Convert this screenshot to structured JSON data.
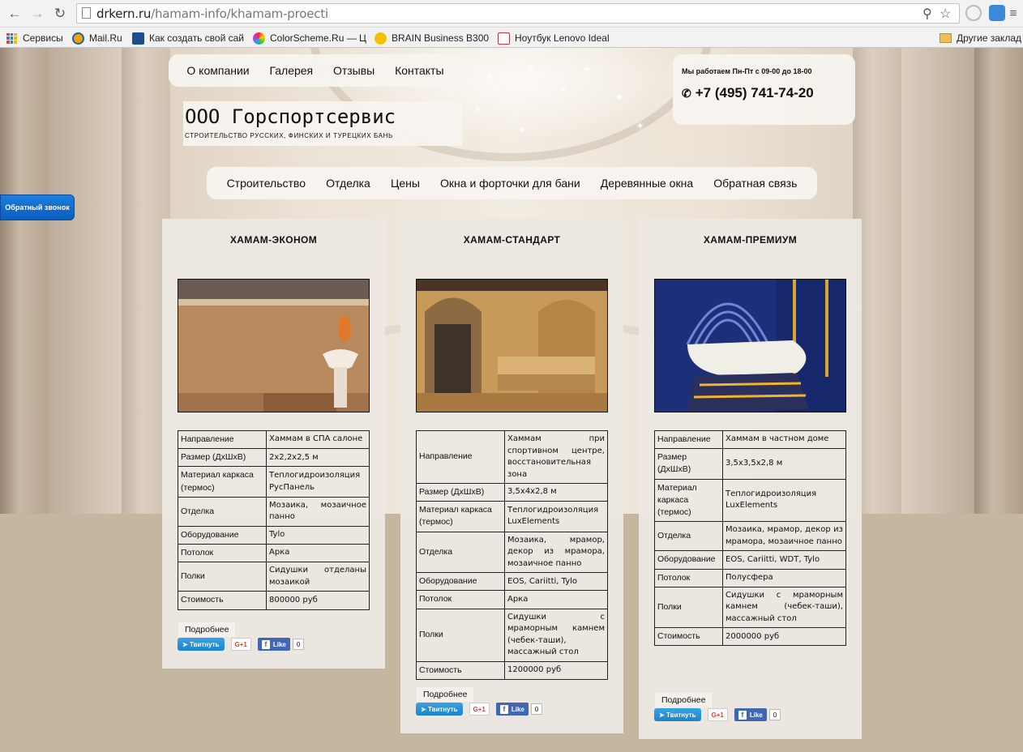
{
  "browser": {
    "url_domain": "drkern.ru",
    "url_path": "/hamam-info/khamam-proecti",
    "bookmarks": [
      {
        "label": "Сервисы"
      },
      {
        "label": "Mail.Ru"
      },
      {
        "label": "Как создать свой сай"
      },
      {
        "label": "ColorScheme.Ru — Ц"
      },
      {
        "label": "BRAIN Business B300"
      },
      {
        "label": "Ноутбук Lenovo Ideal"
      }
    ],
    "other_bookmarks": "Другие заклад"
  },
  "top_nav": [
    "О компании",
    "Галерея",
    "Отзывы",
    "Контакты"
  ],
  "contact": {
    "hours": "Мы работаем Пн-Пт с 09-00 до 18-00",
    "phone": "+7 (495) 741-74-20"
  },
  "logo": {
    "title": "ООО Горспортсервис",
    "subtitle": "Строительство русских, финских и турецких бань"
  },
  "main_nav": [
    "Строительство",
    "Отделка",
    "Цены",
    "Окна и форточки для бани",
    "Деревянные окна",
    "Обратная связь"
  ],
  "callback_label": "Обратный звонок",
  "cards": [
    {
      "title": "ХАМАМ-ЭКОНОМ",
      "specs": [
        {
          "k": "Направление",
          "v": "Хаммам в СПА салоне"
        },
        {
          "k": "Размер (ДхШхВ)",
          "v": "2х2,2х2,5 м"
        },
        {
          "k": "Материал каркаса (термос)",
          "v": "Теплогидроизоляция РусПанель"
        },
        {
          "k": "Отделка",
          "v": "Мозаика, мозаичное панно"
        },
        {
          "k": "Оборудование",
          "v": "Tylo"
        },
        {
          "k": "Потолок",
          "v": "Арка"
        },
        {
          "k": "Полки",
          "v": "Сидушки отделаны мозаикой"
        },
        {
          "k": "Стоимость",
          "v": "800000 руб"
        }
      ],
      "more": "Подробнее",
      "tweet": "Твитнуть",
      "gplus": "G+1",
      "like": "Like",
      "like_count": "0"
    },
    {
      "title": "ХАМАМ-СТАНДАРТ",
      "specs": [
        {
          "k": "Направление",
          "v": "Хаммам при спортивном центре, восстановительная зона"
        },
        {
          "k": "Размер (ДхШхВ)",
          "v": "3,5х4х2,8 м"
        },
        {
          "k": "Материал каркаса (термос)",
          "v": "Теплогидроизоляция LuxElements"
        },
        {
          "k": "Отделка",
          "v": "Мозаика, мрамор, декор из мрамора, мозаичное панно"
        },
        {
          "k": "Оборудование",
          "v": "EOS, Cariitti, Tylo"
        },
        {
          "k": "Потолок",
          "v": "Арка"
        },
        {
          "k": "Полки",
          "v": "Сидушки с мраморным камнем (чебек-таши), массажный стол"
        },
        {
          "k": "Стоимость",
          "v": "1200000 руб"
        }
      ],
      "more": "Подробнее",
      "tweet": "Твитнуть",
      "gplus": "G+1",
      "like": "Like",
      "like_count": "0"
    },
    {
      "title": "ХАМАМ-ПРЕМИУМ",
      "specs": [
        {
          "k": "Направление",
          "v": "Хаммам в частном доме"
        },
        {
          "k": "Размер (ДхШхВ)",
          "v": "3,5х3,5х2,8 м"
        },
        {
          "k": "Материал каркаса (термос)",
          "v": "Теплогидроизоляция LuxElements"
        },
        {
          "k": "Отделка",
          "v": "Мозаика, мрамор, декор из мрамора, мозаичное панно"
        },
        {
          "k": "Оборудование",
          "v": "EOS, Cariitti, WDT, Tylo"
        },
        {
          "k": "Потолок",
          "v": "Полусфера"
        },
        {
          "k": "Полки",
          "v": "Сидушки с мраморным камнем (чебек-таши), массажный стол"
        },
        {
          "k": "Стоимость",
          "v": "2000000 руб"
        }
      ],
      "more": "Подробнее",
      "tweet": "Твитнуть",
      "gplus": "G+1",
      "like": "Like",
      "like_count": "0"
    }
  ]
}
